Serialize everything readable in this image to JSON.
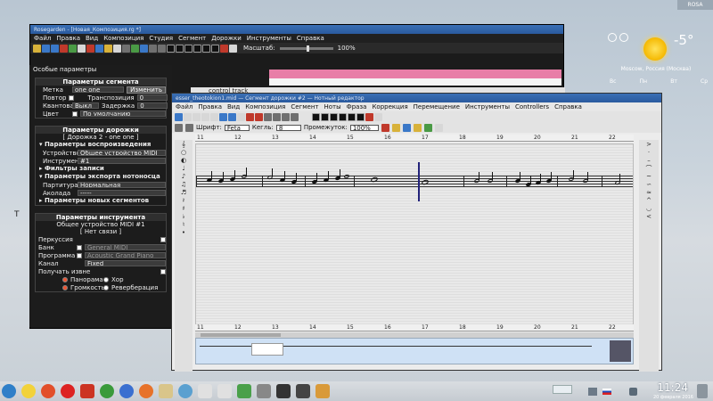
{
  "desktop": {
    "user_tab": "ROSA",
    "cursor_glyph": "T"
  },
  "weather": {
    "temperature": "-5°",
    "city": "Moscow, Россия (Москва)",
    "days": [
      "Вс",
      "Пн",
      "Вт",
      "Ср"
    ]
  },
  "main_window": {
    "title": "Rosegarden - [Новая_Композиция.rg *]",
    "menu": [
      "Файл",
      "Правка",
      "Вид",
      "Композиция",
      "Студия",
      "Сегмент",
      "Дорожки",
      "Инструменты",
      "Справка"
    ],
    "zoom_label": "Масштаб:",
    "zoom_value": "100%",
    "panel_header": "Особые параметры"
  },
  "segment_params": {
    "title": "Параметры сегмента",
    "label_label": "Метка",
    "label_value": "one one",
    "change_button": "Изменить",
    "repeat_label": "Повтор",
    "transpose_label": "Транспозиция",
    "transpose_value": "0",
    "quantize_label": "Квантование",
    "quantize_value": "Выкл",
    "delay_label": "Задержка",
    "delay_value": "0",
    "color_label": "Цвет",
    "color_value": "По умолчанию"
  },
  "track_params": {
    "title": "Параметры дорожки",
    "subtitle": "[ Дорожка 2 - one one ]",
    "playback_title": "▾ Параметры воспроизведения",
    "device_label": "Устройство",
    "device_value": "Общее устройство MIDI",
    "instrument_label": "Инструмент",
    "instrument_value": "#1",
    "record_filters": "▸ Фильтры записи",
    "export_title": "▾ Параметры экспорта нотоносца",
    "score_label": "Партитура",
    "score_value": "Нормальная",
    "bracket_label": "Аколада",
    "bracket_value": "-----",
    "new_segments": "▸ Параметры новых сегментов"
  },
  "instrument_params": {
    "title": "Параметры инструмента",
    "device": "Общее устройство MIDI  #1",
    "connection": "[ Нет связи ]",
    "percussion_label": "Перкуссия",
    "bank_label": "Банк",
    "bank_value": "General MIDI",
    "program_label": "Программа",
    "program_value": "Acoustic Grand Piano",
    "channel_label": "Канал",
    "channel_value": "Fixed",
    "receive_label": "Получать извне",
    "pan_label": "Панорама",
    "chorus_label": "Хор",
    "volume_label": "Громкость",
    "reverb_label": "Реверберация"
  },
  "track_strip": {
    "track_label": "control track"
  },
  "notation_window": {
    "title": "esser_theotokion1.mid — Сегмент дорожки #2 — Нотный редактор",
    "menu": [
      "Файл",
      "Правка",
      "Вид",
      "Композиция",
      "Сегмент",
      "Ноты",
      "Фраза",
      "Коррекция",
      "Перемещение",
      "Инструменты",
      "Controllers",
      "Справка"
    ],
    "font_label": "Шрифт:",
    "font_value": "Feta",
    "size_label": "Кегль:",
    "size_value": "8",
    "spacing_label": "Промежуток:",
    "spacing_value": "100%"
  },
  "ruler_numbers": [
    "11",
    "12",
    "13",
    "14",
    "15",
    "16",
    "17",
    "18",
    "19",
    "20",
    "21",
    "22"
  ],
  "taskbar": {
    "clock": "11:24",
    "date": "20 февраля 2016"
  }
}
